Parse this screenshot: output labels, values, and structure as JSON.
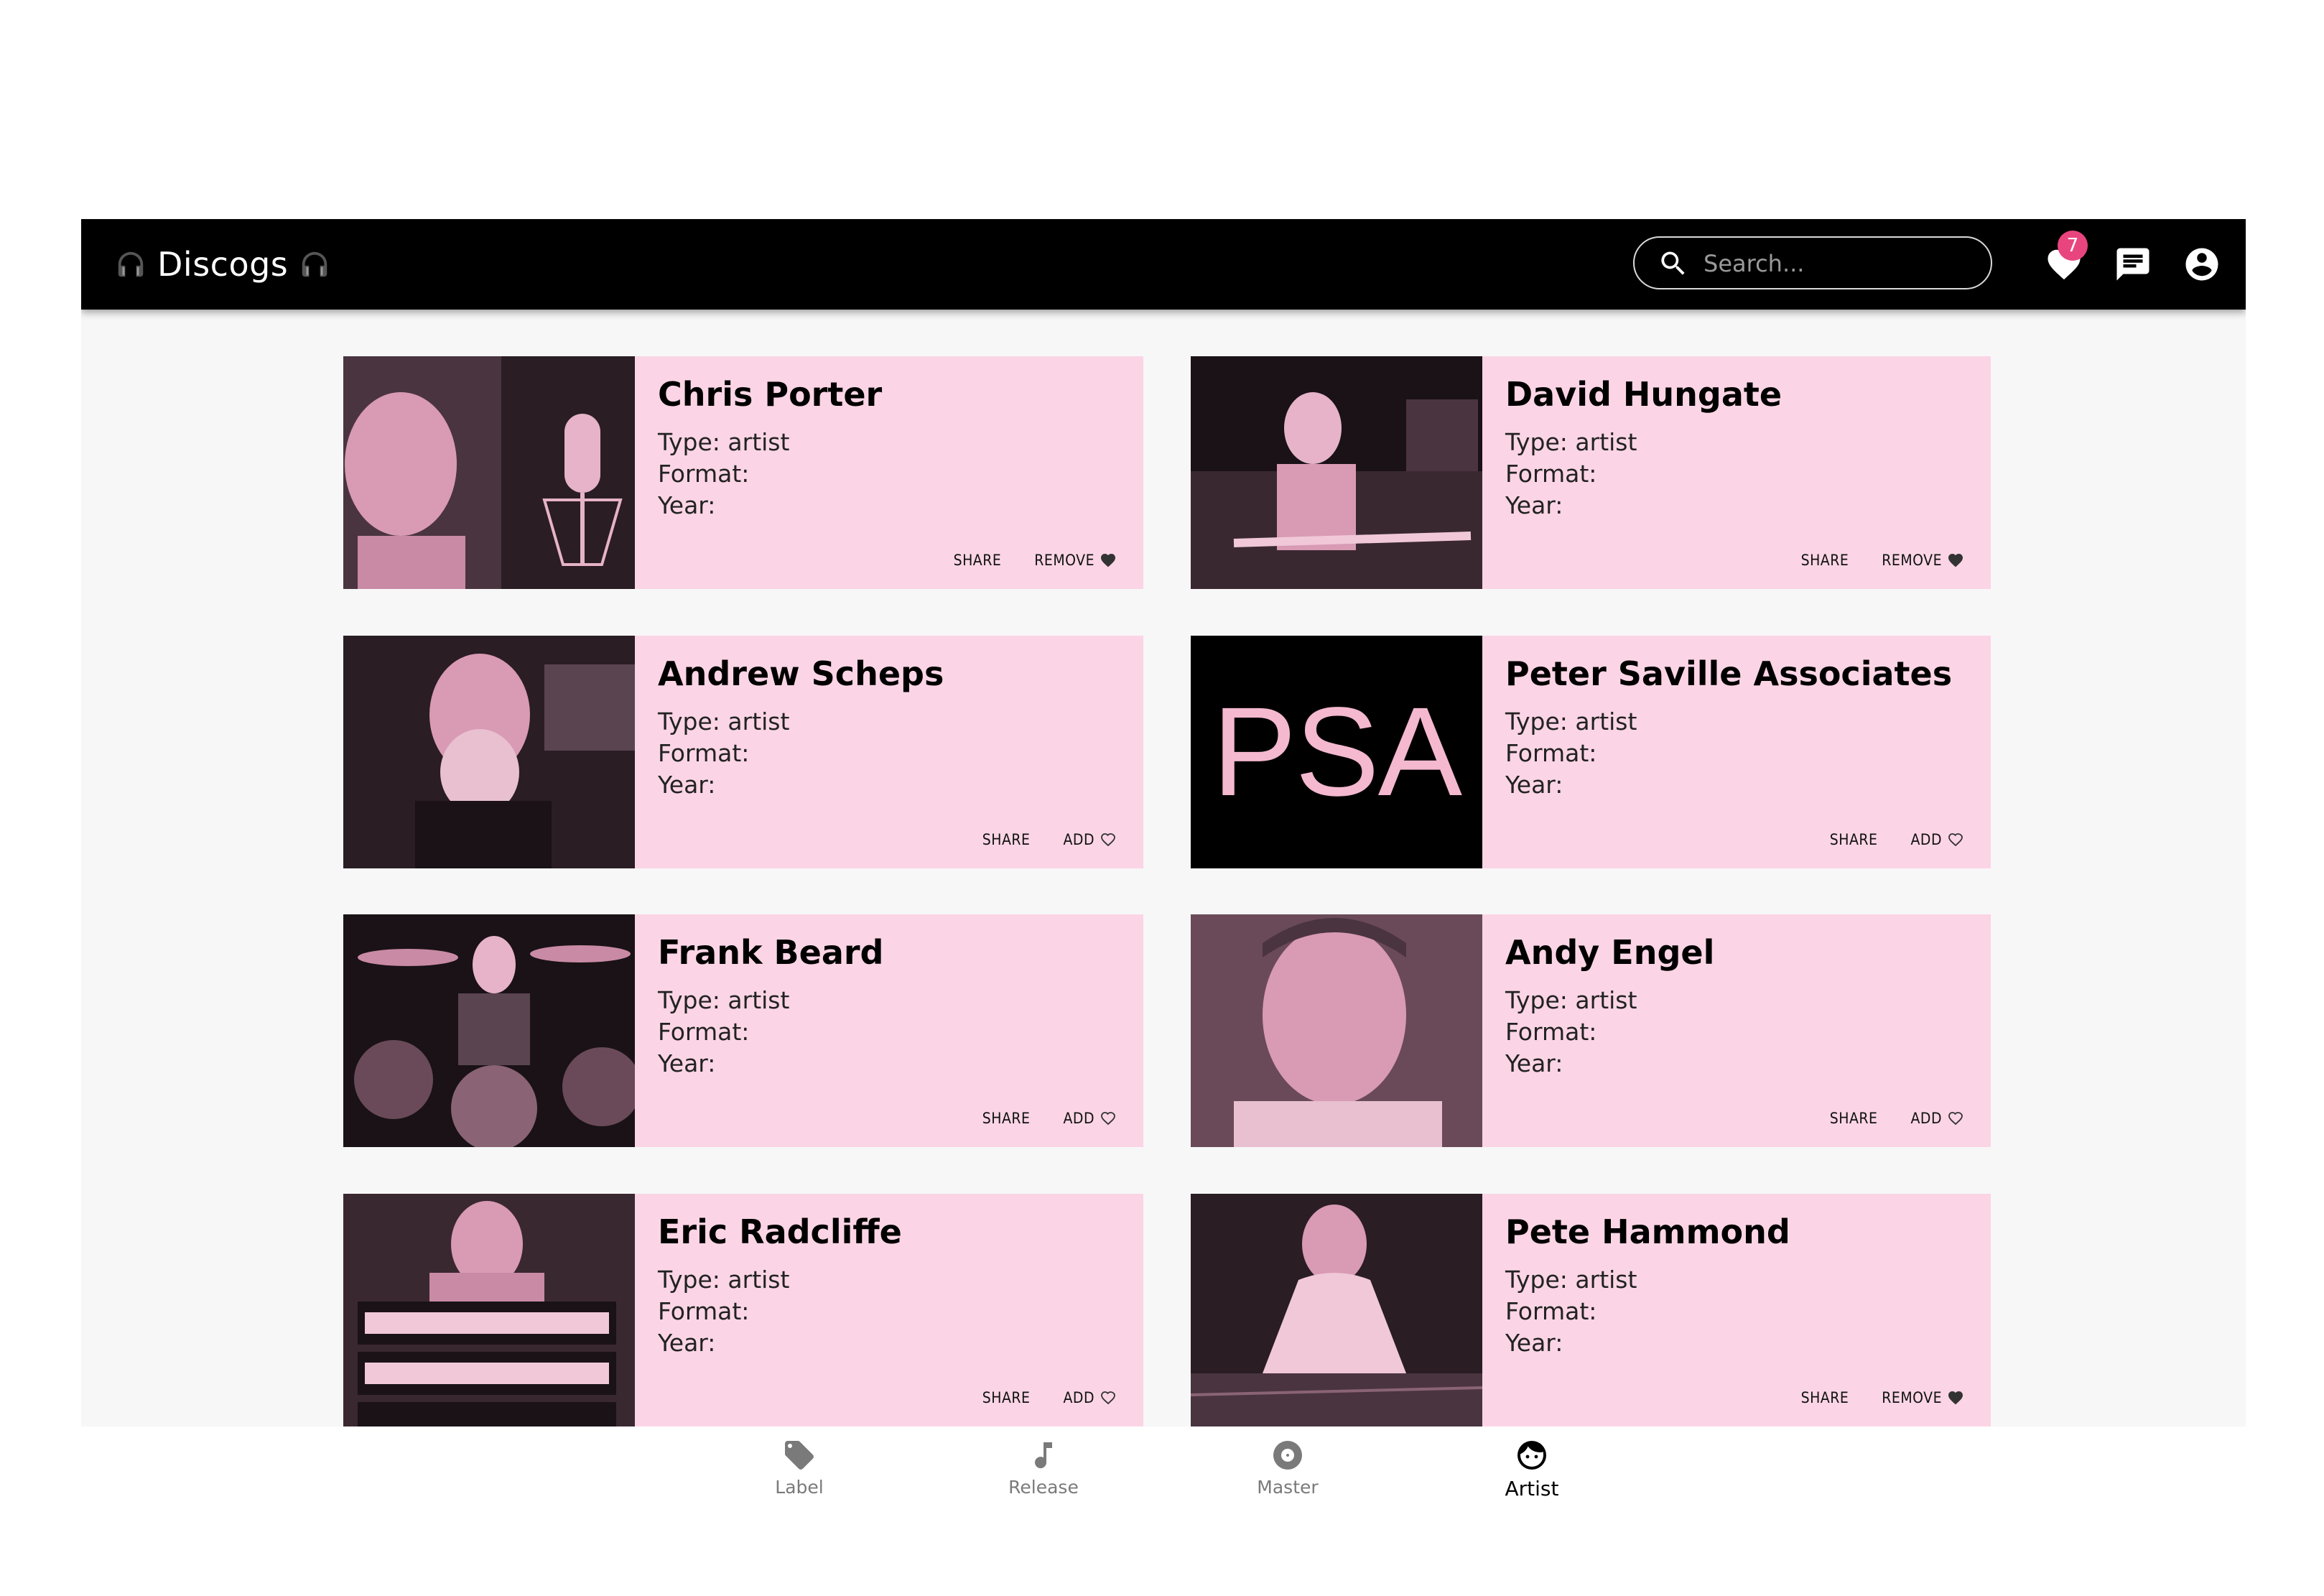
{
  "header": {
    "brand": "Discogs",
    "search_placeholder": "Search...",
    "favorites_count": "7"
  },
  "cards": [
    {
      "name": "Chris Porter",
      "type": "Type: artist",
      "format": "Format:",
      "year": "Year:",
      "share": "SHARE",
      "action": "REMOVE",
      "favorited": true
    },
    {
      "name": "David Hungate",
      "type": "Type: artist",
      "format": "Format:",
      "year": "Year:",
      "share": "SHARE",
      "action": "REMOVE",
      "favorited": true
    },
    {
      "name": "Andrew Scheps",
      "type": "Type: artist",
      "format": "Format:",
      "year": "Year:",
      "share": "SHARE",
      "action": "ADD",
      "favorited": false
    },
    {
      "name": "Peter Saville Associates",
      "type": "Type: artist",
      "format": "Format:",
      "year": "Year:",
      "share": "SHARE",
      "action": "ADD",
      "favorited": false,
      "logo_text": "PSA"
    },
    {
      "name": "Frank Beard",
      "type": "Type: artist",
      "format": "Format:",
      "year": "Year:",
      "share": "SHARE",
      "action": "ADD",
      "favorited": false
    },
    {
      "name": "Andy Engel",
      "type": "Type: artist",
      "format": "Format:",
      "year": "Year:",
      "share": "SHARE",
      "action": "ADD",
      "favorited": false
    },
    {
      "name": "Eric Radcliffe",
      "type": "Type: artist",
      "format": "Format:",
      "year": "Year:",
      "share": "SHARE",
      "action": "ADD",
      "favorited": false
    },
    {
      "name": "Pete Hammond",
      "type": "Type: artist",
      "format": "Format:",
      "year": "Year:",
      "share": "SHARE",
      "action": "REMOVE",
      "favorited": true
    }
  ],
  "bottom_nav": {
    "items": [
      {
        "label": "Label",
        "icon": "tag-icon"
      },
      {
        "label": "Release",
        "icon": "music-note-icon"
      },
      {
        "label": "Master",
        "icon": "disc-icon"
      },
      {
        "label": "Artist",
        "icon": "face-icon"
      }
    ],
    "active": "Artist"
  },
  "colors": {
    "header_bg": "#000000",
    "card_bg": "#fbd5e5",
    "badge": "#e8457f",
    "page_bg": "#f7f7f7"
  }
}
